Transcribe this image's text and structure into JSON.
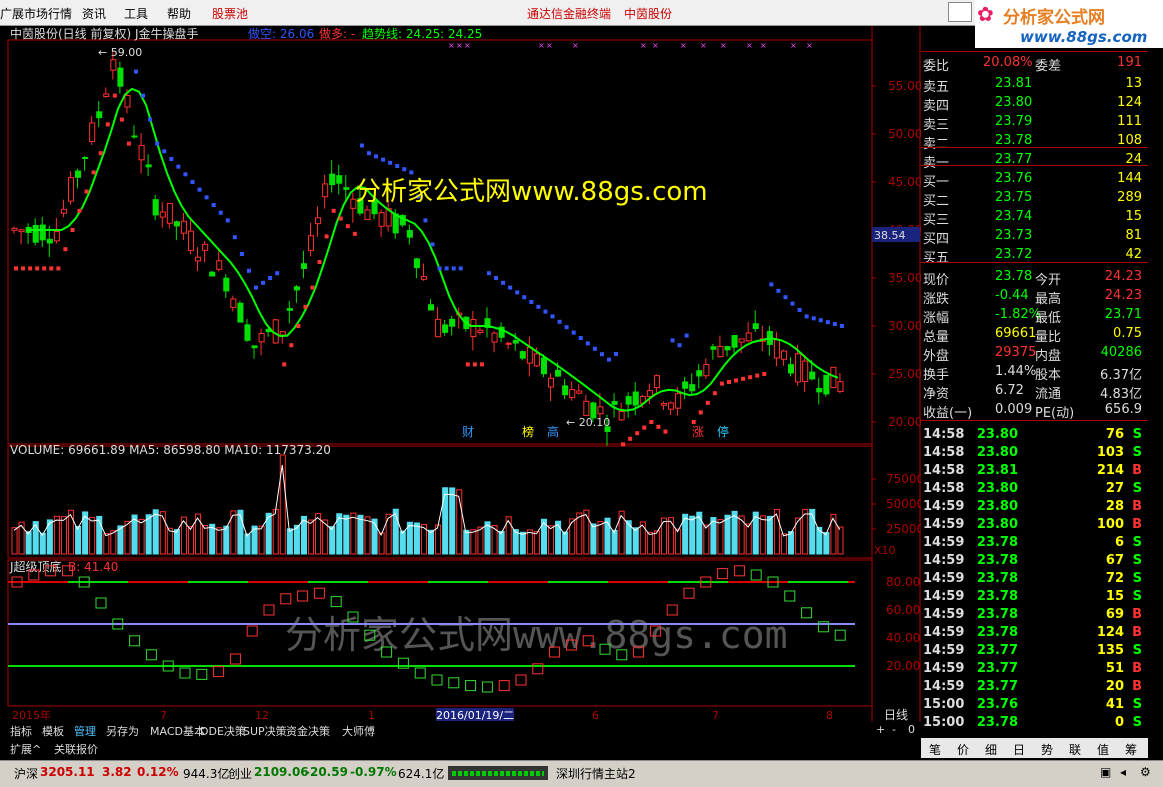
{
  "menu": {
    "items": [
      "广展市场行情",
      "资讯",
      "工具",
      "帮助",
      "股票池"
    ],
    "center": [
      "通达信金融终端",
      "中茵股份"
    ],
    "logo_text": "分析家公式网",
    "logo_url": "www.88gs.com"
  },
  "chart": {
    "title": "中茵股份(日线 前复权) J金牛操盘手",
    "legend": [
      {
        "label": "做空: 26.06",
        "color": "#3355ff"
      },
      {
        "label": "做多: -",
        "color": "#ff3333"
      },
      {
        "label": "趋势线: 24.25",
        "color": "#00ff00"
      },
      {
        "label": ": 24.25",
        "color": "#00ff00"
      }
    ],
    "high_label": "59.00",
    "low_label": "20.10",
    "price_tag": "38.54",
    "watermark1": "分析家公式网www.88gs.com",
    "watermark2": "分析家公式网www.88gs.com",
    "events": [
      {
        "t": "财",
        "c": "#3399ff"
      },
      {
        "t": "榜",
        "c": "#ffff00"
      },
      {
        "t": "高",
        "c": "#3399ff"
      },
      {
        "t": "涨",
        "c": "#ff3333"
      },
      {
        "t": "停",
        "c": "#33ccff"
      }
    ],
    "y_ticks": [
      "55.00",
      "50.00",
      "45.00",
      "40.00",
      "35.00",
      "30.00",
      "25.00",
      "20.00"
    ],
    "volume": {
      "label": "VOLUME: 69661.89  MA5: 86598.80  MA10: 117373.20",
      "ticks": [
        "75000",
        "50000",
        "25000"
      ],
      "unit": "X10"
    },
    "indicator": {
      "label": "J超级顶底",
      "value": "B: 41.40",
      "ticks": [
        "80.00",
        "60.00",
        "40.00",
        "20.00"
      ]
    },
    "x_axis": [
      "2015年",
      "7",
      "12",
      "1",
      "2016/01/19/二",
      "6",
      "7",
      "8"
    ],
    "period": "日线"
  },
  "quote": {
    "weibi": {
      "label": "委比",
      "value": "20.08%",
      "label2": "委差",
      "value2": "191"
    },
    "sells": [
      {
        "label": "卖五",
        "price": "23.81",
        "vol": "13"
      },
      {
        "label": "卖四",
        "price": "23.80",
        "vol": "124"
      },
      {
        "label": "卖三",
        "price": "23.79",
        "vol": "111"
      },
      {
        "label": "卖二",
        "price": "23.78",
        "vol": "108"
      },
      {
        "label": "卖一",
        "price": "23.77",
        "vol": "24"
      }
    ],
    "buys": [
      {
        "label": "买一",
        "price": "23.76",
        "vol": "144"
      },
      {
        "label": "买二",
        "price": "23.75",
        "vol": "289"
      },
      {
        "label": "买三",
        "price": "23.74",
        "vol": "15"
      },
      {
        "label": "买四",
        "price": "23.73",
        "vol": "81"
      },
      {
        "label": "买五",
        "price": "23.72",
        "vol": "42"
      }
    ],
    "stats": [
      {
        "l1": "现价",
        "v1": "23.78",
        "c1": "#00ff00",
        "l2": "今开",
        "v2": "24.23",
        "c2": "#ff3333"
      },
      {
        "l1": "涨跌",
        "v1": "-0.44",
        "c1": "#00ff00",
        "l2": "最高",
        "v2": "24.23",
        "c2": "#ff3333"
      },
      {
        "l1": "涨幅",
        "v1": "-1.82%",
        "c1": "#00ff00",
        "l2": "最低",
        "v2": "23.71",
        "c2": "#00ff00"
      },
      {
        "l1": "总量",
        "v1": "69661",
        "c1": "#ffff00",
        "l2": "量比",
        "v2": "0.75",
        "c2": "#ffff00"
      },
      {
        "l1": "外盘",
        "v1": "29375",
        "c1": "#ff3333",
        "l2": "内盘",
        "v2": "40286",
        "c2": "#00ff00"
      },
      {
        "l1": "换手",
        "v1": "1.44%",
        "c1": "#dddddd",
        "l2": "股本",
        "v2": "6.37亿",
        "c2": "#dddddd"
      },
      {
        "l1": "净资",
        "v1": "6.72",
        "c1": "#dddddd",
        "l2": "流通",
        "v2": "4.83亿",
        "c2": "#dddddd"
      },
      {
        "l1": "收益(一)",
        "v1": "0.009",
        "c1": "#dddddd",
        "l2": "PE(动)",
        "v2": "656.9",
        "c2": "#dddddd"
      }
    ],
    "ticks": [
      {
        "t": "14:58",
        "p": "23.80",
        "v": "76",
        "s": "S"
      },
      {
        "t": "14:58",
        "p": "23.80",
        "v": "103",
        "s": "S"
      },
      {
        "t": "14:58",
        "p": "23.81",
        "v": "214",
        "s": "B"
      },
      {
        "t": "14:58",
        "p": "23.80",
        "v": "27",
        "s": "S"
      },
      {
        "t": "14:59",
        "p": "23.80",
        "v": "28",
        "s": "B"
      },
      {
        "t": "14:59",
        "p": "23.80",
        "v": "100",
        "s": "B"
      },
      {
        "t": "14:59",
        "p": "23.78",
        "v": "6",
        "s": "S"
      },
      {
        "t": "14:59",
        "p": "23.78",
        "v": "67",
        "s": "S"
      },
      {
        "t": "14:59",
        "p": "23.78",
        "v": "72",
        "s": "S"
      },
      {
        "t": "14:59",
        "p": "23.78",
        "v": "15",
        "s": "S"
      },
      {
        "t": "14:59",
        "p": "23.78",
        "v": "69",
        "s": "B"
      },
      {
        "t": "14:59",
        "p": "23.78",
        "v": "124",
        "s": "B"
      },
      {
        "t": "14:59",
        "p": "23.77",
        "v": "135",
        "s": "S"
      },
      {
        "t": "14:59",
        "p": "23.77",
        "v": "51",
        "s": "B"
      },
      {
        "t": "14:59",
        "p": "23.77",
        "v": "20",
        "s": "B"
      },
      {
        "t": "15:00",
        "p": "23.76",
        "v": "41",
        "s": "S"
      },
      {
        "t": "15:00",
        "p": "23.78",
        "v": "0",
        "s": "S"
      }
    ]
  },
  "tabs": [
    "指标",
    "模板",
    "管理",
    "另存为",
    "MACD基本",
    "DDE决策",
    "SUP决策",
    "资金决策",
    "大师傅"
  ],
  "tabs2": [
    "扩展^",
    "关联报价"
  ],
  "bottom_tabs": [
    "笔",
    "价",
    "细",
    "日",
    "势",
    "联",
    "值",
    "筹"
  ],
  "status": {
    "sh_label": "沪深",
    "sh_val": "3205.11",
    "sh_chg": "3.82",
    "sh_pct": "0.12%",
    "sh_amt": "944.3亿",
    "cy_label": "创业",
    "cy_val": "2109.06",
    "cy_chg": "-20.59",
    "cy_pct": "-0.97%",
    "cy_amt": "624.1亿",
    "server": "深圳行情主站2"
  }
}
